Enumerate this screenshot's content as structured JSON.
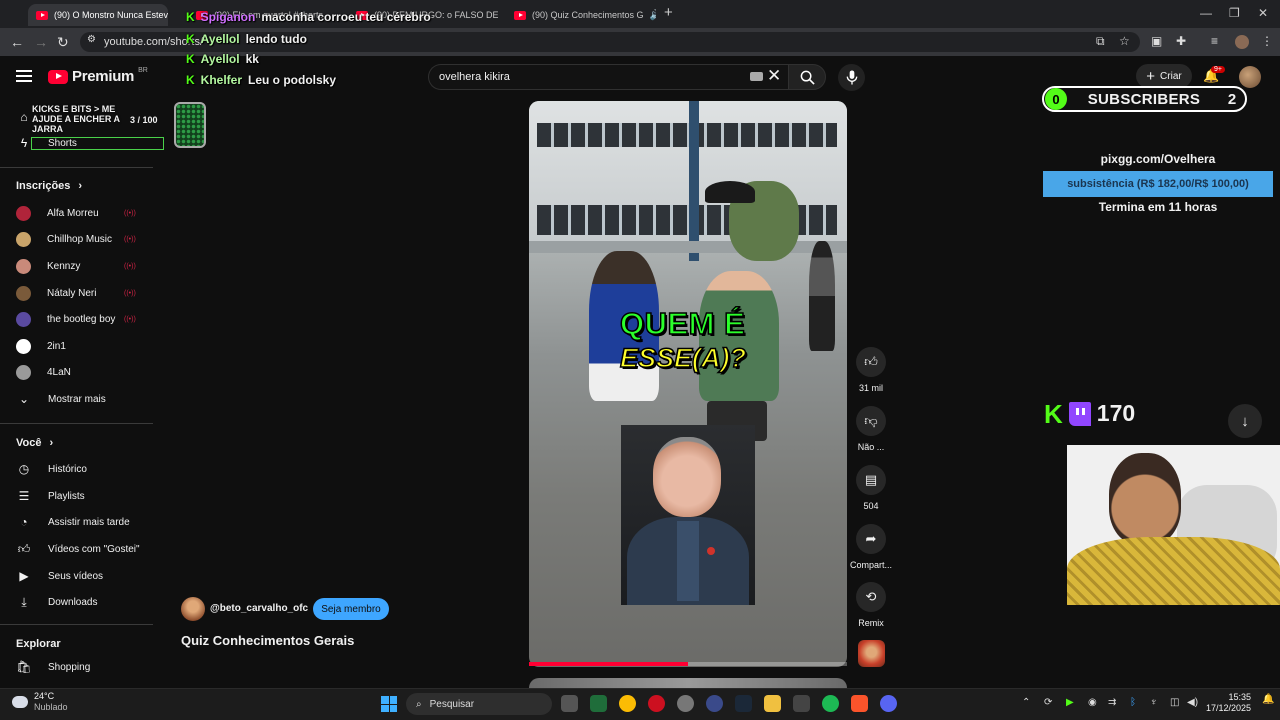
{
  "browser": {
    "tabs": [
      {
        "title": "(90) O Monstro Nunca Esteve n"
      },
      {
        "title": "(90) Ele em quarto! #shorts"
      },
      {
        "title": "(90) DEMIURGO: o FALSO DEUS"
      },
      {
        "title": "(90) Quiz Conhecimentos G"
      }
    ],
    "url": "youtube.com/shorts/"
  },
  "youtube": {
    "logo_text": "Premium",
    "logo_country": "BR",
    "search_value": "ovelhera kikira",
    "create_label": "Criar",
    "notifications_badge": "9+"
  },
  "sidebar": {
    "shorts_label": "Shorts",
    "subscriptions_heading": "Inscrições",
    "channels": [
      {
        "name": "Alfa Morreu",
        "color": "#b0243a"
      },
      {
        "name": "Chillhop Music",
        "color": "#c9a46a"
      },
      {
        "name": "Kennzy",
        "color": "#c98a7a"
      },
      {
        "name": "Nátaly Neri",
        "color": "#7a5a3a"
      },
      {
        "name": "the bootleg boy",
        "color": "#5a4aa0"
      },
      {
        "name": "2in1",
        "color": "#ffffff"
      },
      {
        "name": "4LaN",
        "color": "#9a9a9a"
      }
    ],
    "show_more": "Mostrar mais",
    "you_heading": "Você",
    "you_items": [
      "Histórico",
      "Playlists",
      "Assistir mais tarde",
      "Vídeos com \"Gostei\"",
      "Seus vídeos",
      "Downloads"
    ],
    "explore_heading": "Explorar",
    "explore_items": [
      "Shopping"
    ]
  },
  "overlay_chat": [
    {
      "user": "Spiganon",
      "message": "maconha corroeu teu cérebro"
    },
    {
      "user": "Ayellol",
      "message": "lendo tudo"
    },
    {
      "user": "Ayellol",
      "message": "kk"
    },
    {
      "user": "Khelfer",
      "message": "Leu o podolsky"
    }
  ],
  "goal": {
    "title": "KICKS E BITS > ME AJUDE A ENCHER A JARRA",
    "count": "3 / 100"
  },
  "short": {
    "caption_line1": "QUEM É",
    "caption_line2": "ESSE(A)?",
    "progress": 0.5,
    "channel_handle": "@beto_carvalho_ofc",
    "member_button": "Seja membro",
    "title": "Quiz Conhecimentos Gerais",
    "likes": "31 mil",
    "dislike_label": "Não ...",
    "comments": "504",
    "share_label": "Compart...",
    "remix_label": "Remix"
  },
  "stream_overlay": {
    "subs_left": "0",
    "subs_label": "SUBSCRIBERS",
    "subs_right": "2",
    "pix_url": "pixgg.com/Ovelhera",
    "pix_goal": "subsistência (R$ 182,00/R$ 100,00)",
    "pix_ends": "Termina em 11 horas",
    "viewers": "170"
  },
  "taskbar": {
    "temperature": "24°C",
    "weather": "Nublado",
    "search_placeholder": "Pesquisar",
    "time": "15:35",
    "date": "17/12/2025"
  }
}
